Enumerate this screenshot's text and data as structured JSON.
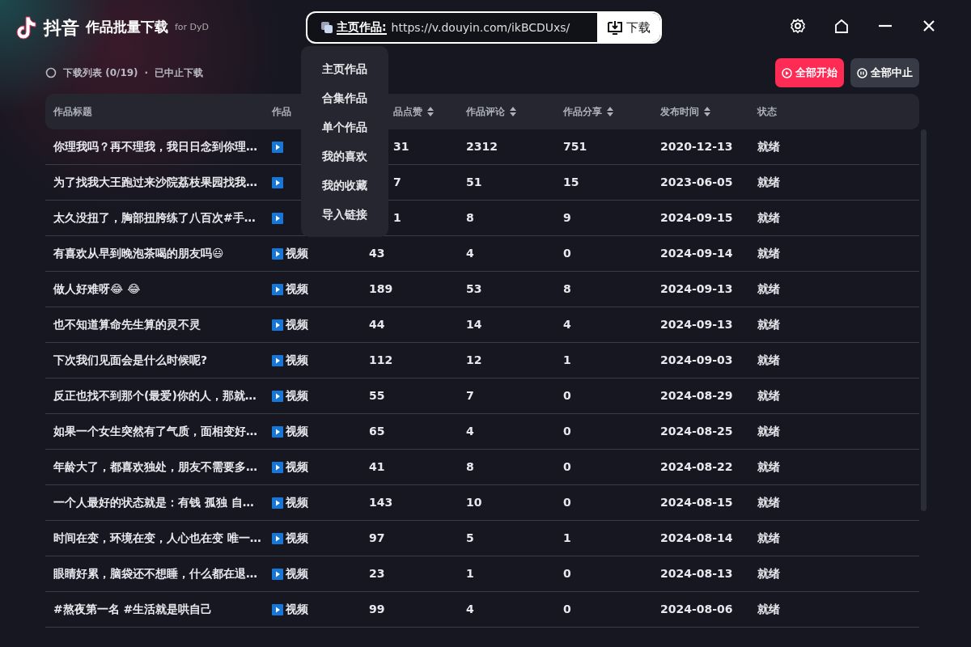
{
  "app": {
    "logo_text": "抖音",
    "title": "作品批量下载",
    "subtitle": "for DyD"
  },
  "url_bar": {
    "mode_label": "主页作品:",
    "value": "https://v.douyin.com/ikBCDUxs/",
    "button": "下载"
  },
  "mode_menu": {
    "expanded": true,
    "items": [
      {
        "label": "主页作品"
      },
      {
        "label": "合集作品"
      },
      {
        "label": "单个作品"
      },
      {
        "label": "我的喜欢"
      },
      {
        "label": "我的收藏"
      },
      {
        "label": "导入链接"
      }
    ]
  },
  "status_line": {
    "count": "下载列表 (0/19)",
    "separator": "·",
    "state": "已中止下载"
  },
  "actions": [
    {
      "label": "全部开始",
      "kind": "primary"
    },
    {
      "label": "全部中止",
      "kind": "secondary"
    }
  ],
  "table": {
    "columns": [
      {
        "label": "作品标题",
        "sortable": false
      },
      {
        "label": "作品",
        "sortable": false
      },
      {
        "label": "品点赞",
        "sortable": true
      },
      {
        "label": "作品评论",
        "sortable": true
      },
      {
        "label": "作品分享",
        "sortable": true
      },
      {
        "label": "发布时间",
        "sortable": true
      },
      {
        "label": "状态",
        "sortable": false
      }
    ],
    "rows": [
      {
        "title": "你理我吗？再不理我，我日日念到你理…",
        "likes": "31",
        "comments": "2312",
        "shares": "751",
        "date": "2020-12-13",
        "status": "就绪"
      },
      {
        "title": "为了找我大王跑过来沙院荔枝果园找我…",
        "likes": "7",
        "comments": "51",
        "shares": "15",
        "date": "2023-06-05",
        "status": "就绪"
      },
      {
        "title": "太久没扭了，胸部扭胯练了八百次#手…",
        "likes": "1",
        "comments": "8",
        "shares": "9",
        "date": "2024-09-15",
        "status": "就绪"
      },
      {
        "title": "有喜欢从早到晚泡茶喝的朋友吗😃",
        "type": "视频",
        "likes": "43",
        "comments": "4",
        "shares": "0",
        "date": "2024-09-14",
        "status": "就绪"
      },
      {
        "title": "做人好难呀😂 😂",
        "type": "视频",
        "likes": "189",
        "comments": "53",
        "shares": "8",
        "date": "2024-09-13",
        "status": "就绪"
      },
      {
        "title": "也不知道算命先生算的灵不灵",
        "type": "视频",
        "likes": "44",
        "comments": "14",
        "shares": "4",
        "date": "2024-09-13",
        "status": "就绪"
      },
      {
        "title": "下次我们见面会是什么时候呢?",
        "type": "视频",
        "likes": "112",
        "comments": "12",
        "shares": "1",
        "date": "2024-09-03",
        "status": "就绪"
      },
      {
        "title": "反正也找不到那个(最爱)你的人，那就…",
        "type": "视频",
        "likes": "55",
        "comments": "7",
        "shares": "0",
        "date": "2024-08-29",
        "status": "就绪"
      },
      {
        "title": "如果一个女生突然有了气质，面相变好…",
        "type": "视频",
        "likes": "65",
        "comments": "4",
        "shares": "0",
        "date": "2024-08-25",
        "status": "就绪"
      },
      {
        "title": "年龄大了，都喜欢独处，朋友不需要多…",
        "type": "视频",
        "likes": "41",
        "comments": "8",
        "shares": "0",
        "date": "2024-08-22",
        "status": "就绪"
      },
      {
        "title": "一个人最好的状态就是：有钱 孤独 自…",
        "type": "视频",
        "likes": "143",
        "comments": "10",
        "shares": "0",
        "date": "2024-08-15",
        "status": "就绪"
      },
      {
        "title": "时间在变，环境在变，人心也在变 唯一…",
        "type": "视频",
        "likes": "97",
        "comments": "5",
        "shares": "1",
        "date": "2024-08-14",
        "status": "就绪"
      },
      {
        "title": "眼睛好累，脑袋还不想睡，什么都在退…",
        "type": "视频",
        "likes": "23",
        "comments": "1",
        "shares": "0",
        "date": "2024-08-13",
        "status": "就绪"
      },
      {
        "title": "#熬夜第一名 #生活就是哄自己",
        "type": "视频",
        "likes": "99",
        "comments": "4",
        "shares": "0",
        "date": "2024-08-06",
        "status": "就绪"
      }
    ]
  }
}
